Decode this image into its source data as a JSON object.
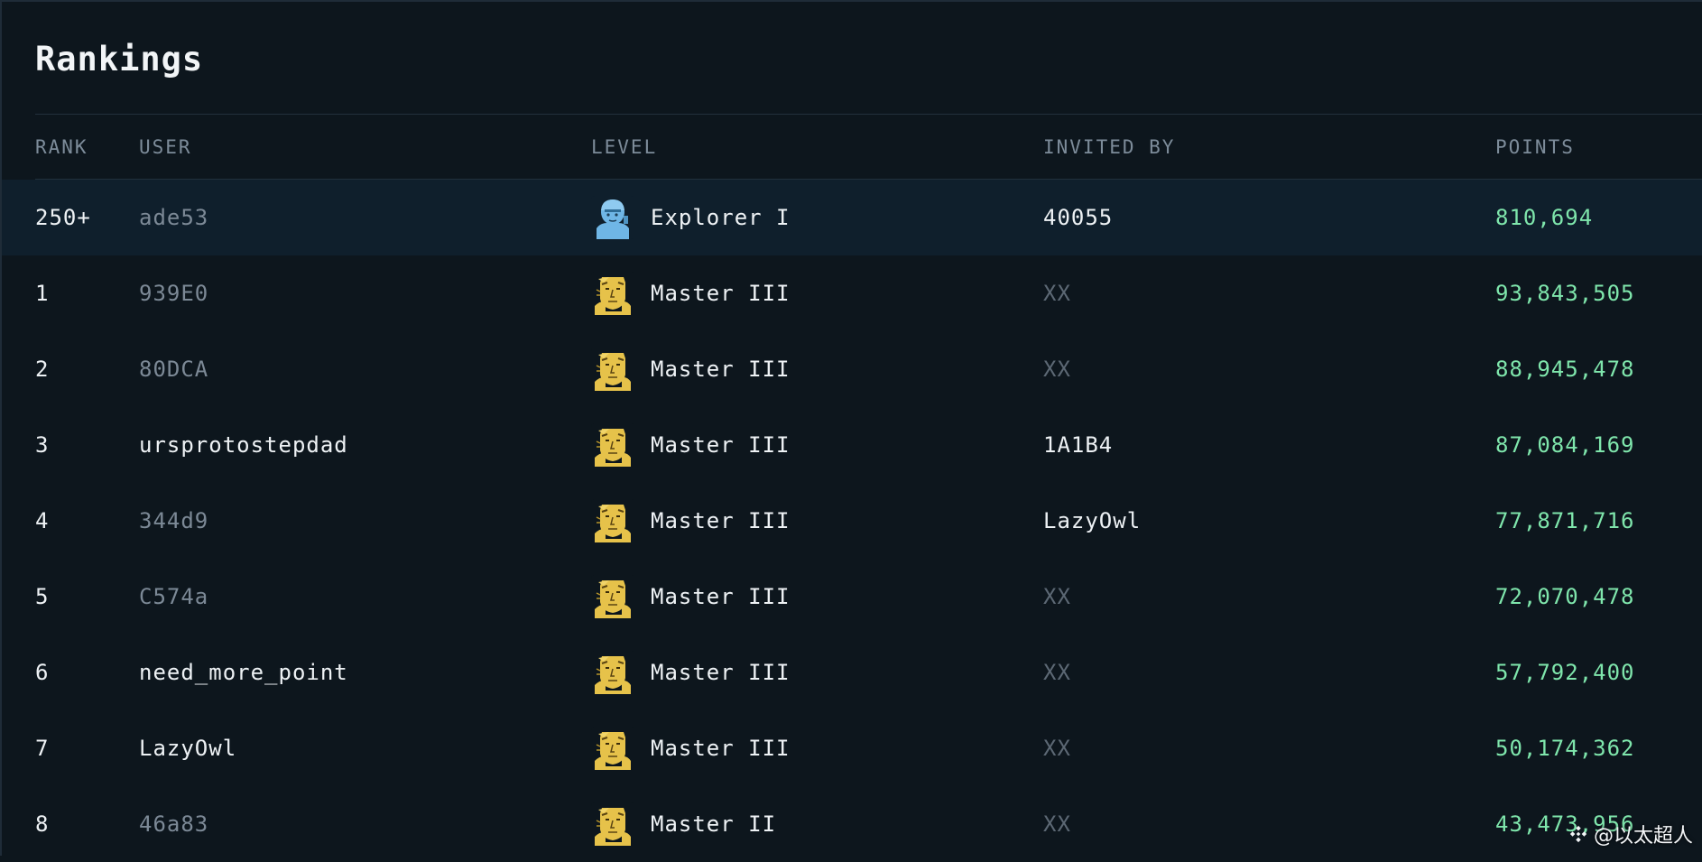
{
  "page": {
    "title": "Rankings"
  },
  "columns": {
    "rank": "RANK",
    "user": "USER",
    "level": "LEVEL",
    "invited_by": "INVITED BY",
    "points": "POINTS"
  },
  "rows": [
    {
      "rank": "250+",
      "user": "ade53",
      "user_muted": true,
      "level": "Explorer I",
      "tier": "explorer",
      "invited_by": "40055",
      "invited_muted": false,
      "points": "810,694",
      "current": true
    },
    {
      "rank": "1",
      "user": "939E0",
      "user_muted": true,
      "level": "Master III",
      "tier": "master",
      "invited_by": "XX",
      "invited_muted": true,
      "points": "93,843,505",
      "current": false
    },
    {
      "rank": "2",
      "user": "80DCA",
      "user_muted": true,
      "level": "Master III",
      "tier": "master",
      "invited_by": "XX",
      "invited_muted": true,
      "points": "88,945,478",
      "current": false
    },
    {
      "rank": "3",
      "user": "ursprotostepdad",
      "user_muted": false,
      "level": "Master III",
      "tier": "master",
      "invited_by": "1A1B4",
      "invited_muted": false,
      "points": "87,084,169",
      "current": false
    },
    {
      "rank": "4",
      "user": "344d9",
      "user_muted": true,
      "level": "Master III",
      "tier": "master",
      "invited_by": "LazyOwl",
      "invited_muted": false,
      "points": "77,871,716",
      "current": false
    },
    {
      "rank": "5",
      "user": "C574a",
      "user_muted": true,
      "level": "Master III",
      "tier": "master",
      "invited_by": "XX",
      "invited_muted": true,
      "points": "72,070,478",
      "current": false
    },
    {
      "rank": "6",
      "user": "need_more_point",
      "user_muted": false,
      "level": "Master III",
      "tier": "master",
      "invited_by": "XX",
      "invited_muted": true,
      "points": "57,792,400",
      "current": false
    },
    {
      "rank": "7",
      "user": "LazyOwl",
      "user_muted": false,
      "level": "Master III",
      "tier": "master",
      "invited_by": "XX",
      "invited_muted": true,
      "points": "50,174,362",
      "current": false
    },
    {
      "rank": "8",
      "user": "46a83",
      "user_muted": true,
      "level": "Master II",
      "tier": "master",
      "invited_by": "XX",
      "invited_muted": true,
      "points": "43,473,956",
      "current": false
    }
  ],
  "colors": {
    "background": "#0d161d",
    "highlight_row": "#0f1f2c",
    "points": "#7fe6ac",
    "muted": "#7c8996",
    "explorer_avatar": "#6fb6e6",
    "master_avatar": "#e6c24a"
  },
  "icons": {
    "explorer": "astronaut-avatar-icon",
    "master": "statue-head-avatar-icon",
    "watermark": "binance-logo-icon"
  },
  "watermark": {
    "text": "@以太超人"
  }
}
